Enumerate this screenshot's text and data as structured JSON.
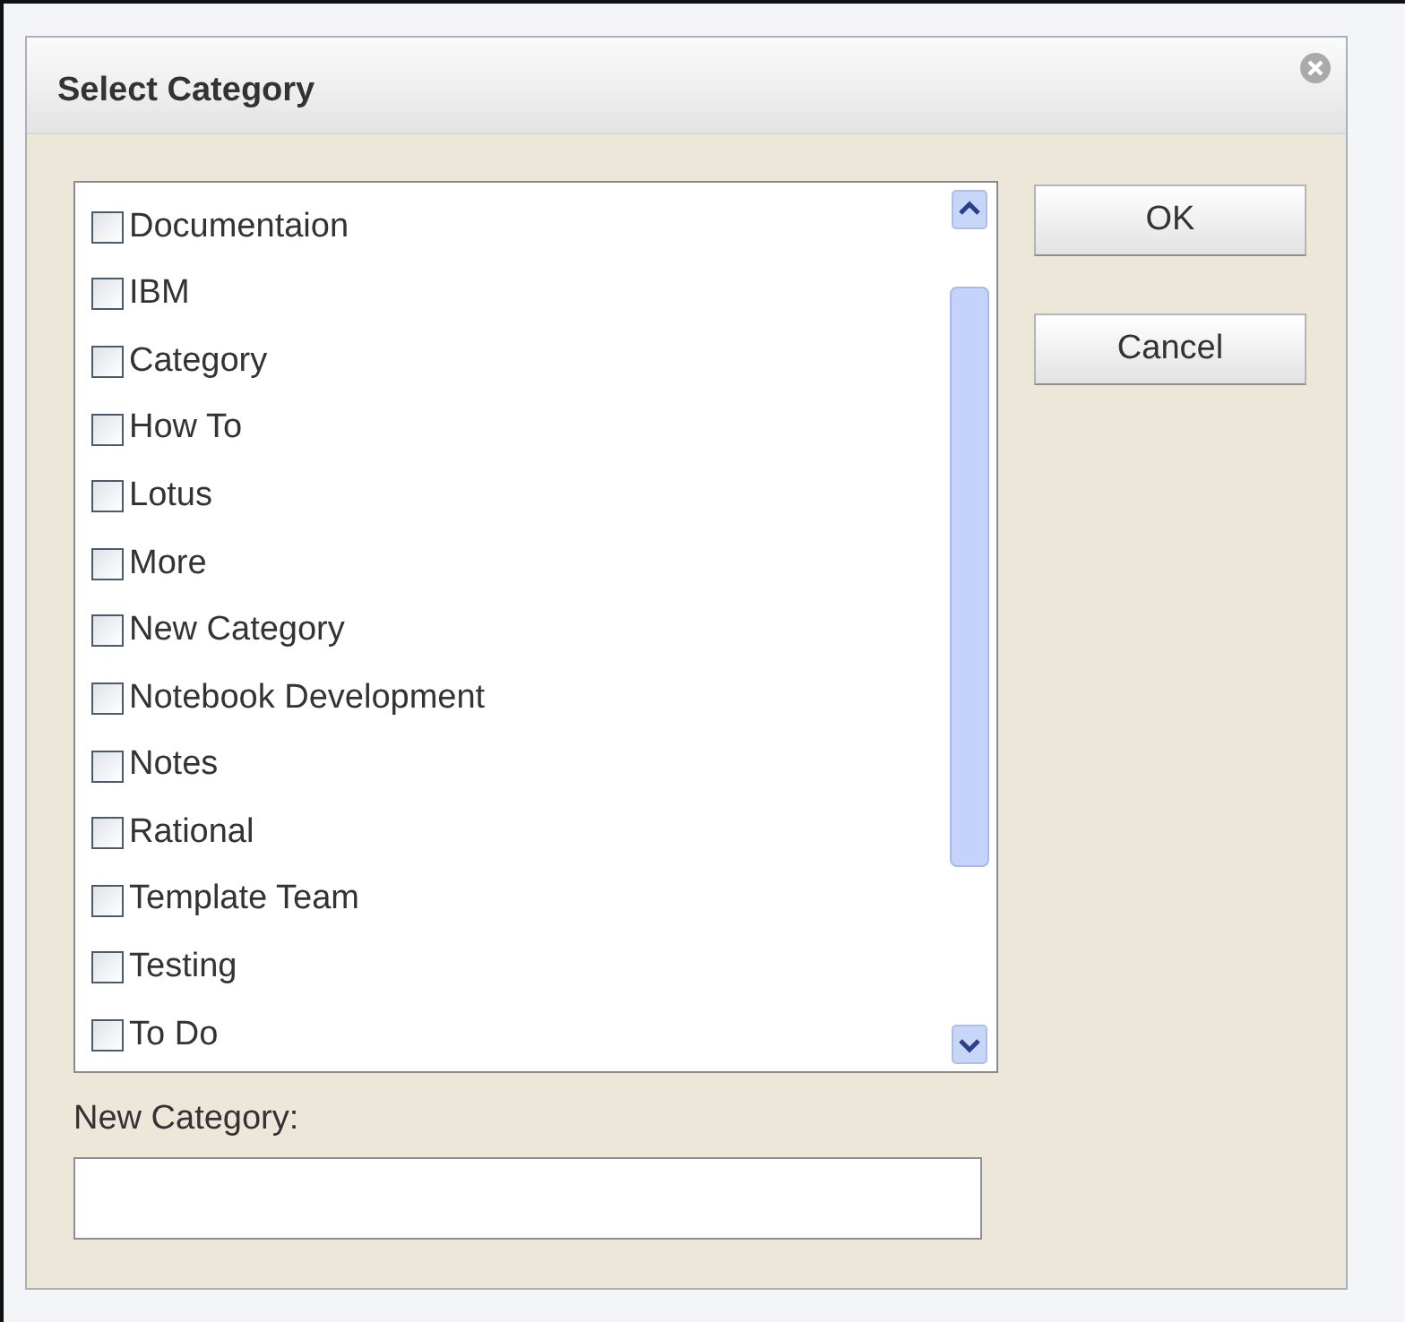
{
  "dialog": {
    "title": "Select Category",
    "categories": [
      {
        "label": "Documentaion",
        "checked": false
      },
      {
        "label": "IBM",
        "checked": false
      },
      {
        "label": "Category",
        "checked": false
      },
      {
        "label": "How To",
        "checked": false
      },
      {
        "label": "Lotus",
        "checked": false
      },
      {
        "label": "More",
        "checked": false
      },
      {
        "label": "New Category",
        "checked": false
      },
      {
        "label": "Notebook Development",
        "checked": false
      },
      {
        "label": "Notes",
        "checked": false
      },
      {
        "label": "Rational",
        "checked": false
      },
      {
        "label": "Template Team",
        "checked": false
      },
      {
        "label": "Testing",
        "checked": false
      },
      {
        "label": "To Do",
        "checked": false
      }
    ],
    "buttons": [
      "OK",
      "Cancel"
    ],
    "new_category": {
      "label": "New Category:"
    }
  }
}
